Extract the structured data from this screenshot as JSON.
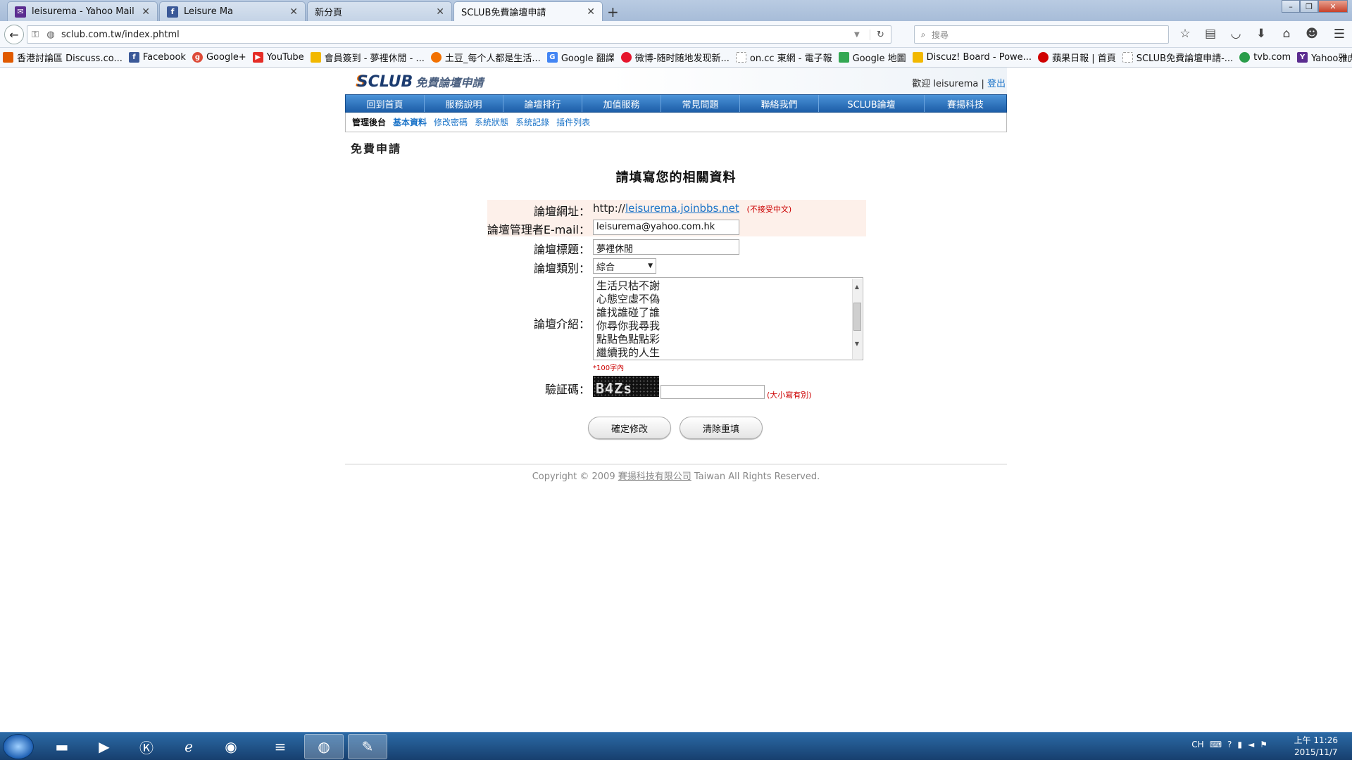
{
  "browser": {
    "tabs": [
      {
        "label": "leisurema - Yahoo Mail",
        "icon": "yahoo-mail-icon",
        "color": "#5b2d90"
      },
      {
        "label": "Leisure Ma",
        "icon": "facebook-icon",
        "color": "#3b5998"
      },
      {
        "label": "新分頁",
        "icon": "",
        "color": ""
      },
      {
        "label": "SCLUB免費論壇申請",
        "icon": "",
        "color": ""
      }
    ],
    "url": "sclub.com.tw/index.phtml",
    "search_placeholder": "搜尋",
    "bookmarks": [
      {
        "label": "香港討論區 Discuss.co...",
        "color": "#e05a00"
      },
      {
        "label": "Facebook",
        "color": "#3b5998"
      },
      {
        "label": "Google+",
        "color": "#dd4b39"
      },
      {
        "label": "YouTube",
        "color": "#e52d27"
      },
      {
        "label": "會員簽到 - 夢裡休閒 - ...",
        "color": "#f2b800"
      },
      {
        "label": "土豆_每个人都是生活...",
        "color": "#f27100"
      },
      {
        "label": "Google 翻譯",
        "color": "#4285f4"
      },
      {
        "label": "微博-随时随地发现新...",
        "color": "#e6162d"
      },
      {
        "label": "on.cc 東網 - 電子報",
        "color": "#999999"
      },
      {
        "label": "Google 地圖",
        "color": "#34a853"
      },
      {
        "label": "Discuz! Board - Powe...",
        "color": "#f2b800"
      },
      {
        "label": "蘋果日報 | 首頁",
        "color": "#d00000"
      },
      {
        "label": "SCLUB免費論壇申請-...",
        "color": "#999999"
      },
      {
        "label": "tvb.com",
        "color": "#2a9d4a"
      },
      {
        "label": "Yahoo雅虎香港",
        "color": "#5b2d90"
      }
    ]
  },
  "site": {
    "logo_mark": "SCLUB",
    "logo_sub": "免費論壇申請",
    "welcome": "歡迎 leisurema |",
    "logout": "登出",
    "nav": [
      "回到首頁",
      "服務說明",
      "論壇排行",
      "加值服務",
      "常見問題",
      "聯絡我們",
      "SCLUB論壇",
      "賽揚科技"
    ],
    "subnav": {
      "current": "管理後台",
      "links": [
        "基本資料",
        "修改密碼",
        "系統狀態",
        "系統記錄",
        "插件列表"
      ]
    },
    "page_title": "免費申請",
    "form_title": "請填寫您的相關資料"
  },
  "form": {
    "url_label": "論壇網址：",
    "url_prefix": "http://",
    "url_value": "leisurema.joinbbs.net",
    "url_note": "(不接受中文)",
    "email_label": "論壇管理者E-mail：",
    "email_value": "leisurema@yahoo.com.hk",
    "title_label": "論壇標題：",
    "title_value": "夢裡休閒",
    "category_label": "論壇類別：",
    "category_value": "綜合",
    "intro_label": "論壇介紹：",
    "intro_lines": [
      "生活只枯不謝",
      "心態空虛不偽",
      "誰找誰碰了誰",
      "你尋你我尋我",
      "點點色點點彩",
      "繼續我的人生"
    ],
    "intro_note": "*100字內",
    "captcha_label": "驗証碼：",
    "captcha_text": "B4Zs",
    "captcha_note": "(大小寫有別)",
    "submit": "確定修改",
    "reset": "清除重填"
  },
  "footer": {
    "prefix": "Copyright © 2009",
    "company": "賽揚科技有限公司",
    "suffix": "Taiwan All Rights Reserved."
  },
  "taskbar": {
    "lang": "CH",
    "time": "上午 11:26",
    "date": "2015/11/7"
  }
}
